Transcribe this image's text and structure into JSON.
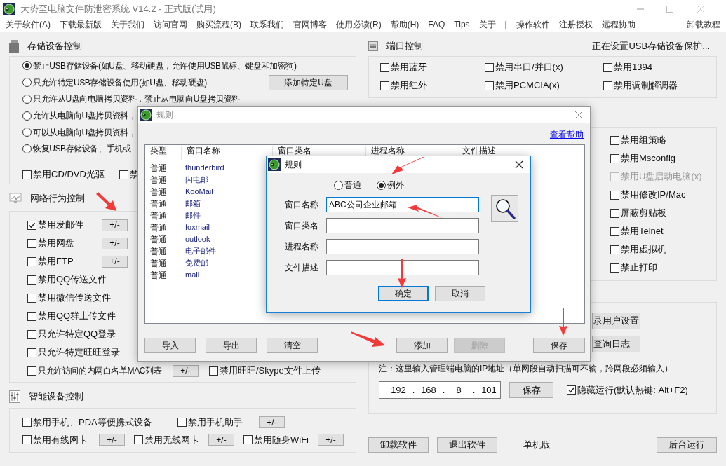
{
  "window": {
    "title": "大势至电脑文件防泄密系统 V14.2 - 正式版(试用)"
  },
  "menu": [
    {
      "label": "关于软件(A)"
    },
    {
      "label": "下载最新版"
    },
    {
      "label": "关于我们"
    },
    {
      "label": "访问官网"
    },
    {
      "label": "购买流程(B)"
    },
    {
      "label": "联系我们"
    },
    {
      "label": "官网博客"
    },
    {
      "label": "使用必读(R)"
    },
    {
      "label": "帮助(H)"
    },
    {
      "label": "FAQ"
    },
    {
      "label": "Tips"
    },
    {
      "label": "关于"
    },
    {
      "label": "|"
    },
    {
      "label": "操作软件"
    },
    {
      "label": "注册授权"
    },
    {
      "label": "远程协助"
    }
  ],
  "menu_right": "卸载教程",
  "storage": {
    "title": "存储设备控制",
    "options": [
      {
        "label": "禁止USB存储设备(如U盘、移动硬盘，允许使用USB鼠标、键盘和加密狗)",
        "selected": true
      },
      {
        "label": "只允许特定USB存储设备使用(如U盘、移动硬盘)",
        "selected": false
      },
      {
        "label": "只允许从U盘向电脑拷贝资料，禁止从电脑向U盘拷贝资料",
        "selected": false
      },
      {
        "label": "允许从电脑向U盘拷贝资料，",
        "selected": false
      },
      {
        "label": "可以从电脑向U盘拷贝资料，",
        "selected": false
      },
      {
        "label": "恢复USB存储设备、手机或",
        "selected": false
      }
    ],
    "add_button": "添加特定U盘",
    "checkboxes": [
      {
        "label": "禁用CD/DVD光驱",
        "checked": false
      },
      {
        "label": "禁",
        "checked": false
      }
    ]
  },
  "network": {
    "title": "网络行为控制",
    "rows": [
      [
        {
          "label": "禁用发邮件",
          "checked": true,
          "button": "+/-"
        }
      ],
      [
        {
          "label": "禁用网盘",
          "checked": false,
          "button": "+/-"
        }
      ],
      [
        {
          "label": "禁用FTP",
          "checked": false,
          "button": "+/-"
        }
      ],
      [
        {
          "label": "禁用QQ传送文件",
          "checked": false
        }
      ],
      [
        {
          "label": "禁用微信传送文件",
          "checked": false
        }
      ],
      [
        {
          "label": "禁用QQ群上传文件",
          "checked": false
        }
      ],
      [
        {
          "label": "只允许特定QQ登录",
          "checked": false
        }
      ],
      [
        {
          "label": "只允许特定旺旺登录",
          "checked": false
        }
      ],
      [
        {
          "label": "只允许访问的内网白名单MAC列表",
          "checked": false,
          "button": "+/-"
        },
        {
          "label": "禁用旺旺/Skype文件上传",
          "checked": false
        }
      ]
    ]
  },
  "smart": {
    "title": "智能设备控制",
    "rows": [
      [
        {
          "label": "禁用手机、PDA等便携式设备",
          "checked": false
        },
        {
          "label": "禁用手机助手",
          "checked": false,
          "button": "+/-"
        }
      ],
      [
        {
          "label": "禁用有线网卡",
          "checked": false,
          "button": "+/-"
        },
        {
          "label": "禁用无线网卡",
          "checked": false,
          "button": "+/-"
        },
        {
          "label": "禁用随身WiFi",
          "checked": false,
          "button": "+/-"
        }
      ]
    ]
  },
  "port": {
    "title": "端口控制",
    "status": "正在设置USB存储设备保护...",
    "checkboxes": [
      {
        "label": "禁用蓝牙",
        "checked": false
      },
      {
        "label": "禁用串口/并口(x)",
        "checked": false
      },
      {
        "label": "禁用1394",
        "checked": false
      },
      {
        "label": "禁用红外",
        "checked": false
      },
      {
        "label": "禁用PCMCIA(x)",
        "checked": false
      },
      {
        "label": "禁用调制解调器",
        "checked": false
      }
    ]
  },
  "system": {
    "items": [
      {
        "label": "禁用组策略",
        "checked": false,
        "disabled": false
      },
      {
        "label": "禁用Msconfig",
        "checked": false,
        "disabled": false
      },
      {
        "label": "禁用U盘启动电脑(x)",
        "checked": false,
        "disabled": true
      },
      {
        "label": "禁用修改IP/Mac",
        "checked": false,
        "disabled": false
      },
      {
        "label": "屏蔽剪贴板",
        "checked": false,
        "disabled": false
      },
      {
        "label": "禁用Telnet",
        "checked": false,
        "disabled": false
      },
      {
        "label": "禁用虚拟机",
        "checked": false,
        "disabled": false
      },
      {
        "label": "禁止打印",
        "checked": false,
        "disabled": false
      }
    ]
  },
  "admin": {
    "buttons": [
      "录用户设置",
      "查询日志"
    ],
    "note": "注：这里输入管理端电脑的IP地址（单网段自动扫描可不输，跨网段必须输入）",
    "ip": [
      "192",
      ".",
      "168",
      ".",
      "8",
      ".",
      "101"
    ],
    "save_button": "保存",
    "hide": {
      "label": "隐藏运行(默认热键: Alt+F2)",
      "checked": true
    }
  },
  "footer": {
    "buttons": [
      "卸载软件",
      "退出软件"
    ],
    "mode": "单机版",
    "background_button": "后台运行"
  },
  "rules_dialog": {
    "title": "规则",
    "help_link": "查看帮助",
    "columns": [
      "类型",
      "窗口名称",
      "窗口类名",
      "进程名称",
      "文件描述"
    ],
    "rows": [
      {
        "type": "普通",
        "window_name": "thunderbird"
      },
      {
        "type": "普通",
        "window_name": "闪电邮"
      },
      {
        "type": "普通",
        "window_name": "KooMail"
      },
      {
        "type": "普通",
        "window_name": "邮箱"
      },
      {
        "type": "普通",
        "window_name": "邮件"
      },
      {
        "type": "普通",
        "window_name": "foxmail"
      },
      {
        "type": "普通",
        "window_name": "outlook"
      },
      {
        "type": "普通",
        "window_name": "电子邮件"
      },
      {
        "type": "普通",
        "window_name": "免费邮"
      },
      {
        "type": "普通",
        "window_name": "mail"
      }
    ],
    "left_buttons": [
      {
        "label": "导入",
        "disabled": false
      },
      {
        "label": "导出",
        "disabled": false
      },
      {
        "label": "清空",
        "disabled": false
      }
    ],
    "right_buttons": [
      {
        "label": "添加",
        "disabled": false
      },
      {
        "label": "删除",
        "disabled": true
      }
    ],
    "save_button": "保存"
  },
  "rule_editor": {
    "title": "规则",
    "types": [
      {
        "label": "普通",
        "selected": false
      },
      {
        "label": "例外",
        "selected": true
      }
    ],
    "fields": [
      {
        "label": "窗口名称",
        "value": "ABC公司企业邮箱",
        "focused": true
      },
      {
        "label": "窗口类名",
        "focused": false
      },
      {
        "label": "进程名称",
        "focused": false
      },
      {
        "label": "文件描述",
        "focused": false
      }
    ],
    "buttons": [
      {
        "label": "确定",
        "default": true
      },
      {
        "label": "取消",
        "default": false
      }
    ]
  }
}
